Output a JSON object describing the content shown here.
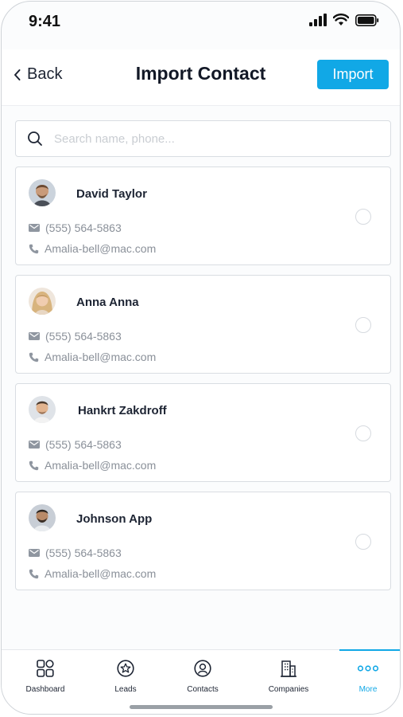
{
  "status_bar": {
    "time": "9:41"
  },
  "header": {
    "back_label": "Back",
    "title": "Import Contact",
    "import_label": "Import"
  },
  "search": {
    "placeholder": "Search name, phone..."
  },
  "contacts": [
    {
      "name": "David Taylor",
      "phone": "(555) 564-5863",
      "email": "Amalia-bell@mac.com",
      "selected": false
    },
    {
      "name": "Anna Anna",
      "phone": "(555) 564-5863",
      "email": "Amalia-bell@mac.com",
      "selected": false
    },
    {
      "name": "Hankrt Zakdroff",
      "phone": "(555) 564-5863",
      "email": "Amalia-bell@mac.com",
      "selected": false
    },
    {
      "name": "Johnson App",
      "phone": "(555) 564-5863",
      "email": "Amalia-bell@mac.com",
      "selected": false
    }
  ],
  "tabbar": {
    "active": "More",
    "items": [
      {
        "label": "Dashboard",
        "icon": "dashboard-grid-icon"
      },
      {
        "label": "Leads",
        "icon": "star-badge-icon"
      },
      {
        "label": "Contacts",
        "icon": "contact-circle-icon"
      },
      {
        "label": "Companies",
        "icon": "building-icon"
      },
      {
        "label": "More",
        "icon": "more-dots-icon"
      }
    ]
  },
  "colors": {
    "accent": "#11a8e6",
    "text": "#1d2433",
    "muted": "#8a9099",
    "border": "#d9dde2"
  }
}
